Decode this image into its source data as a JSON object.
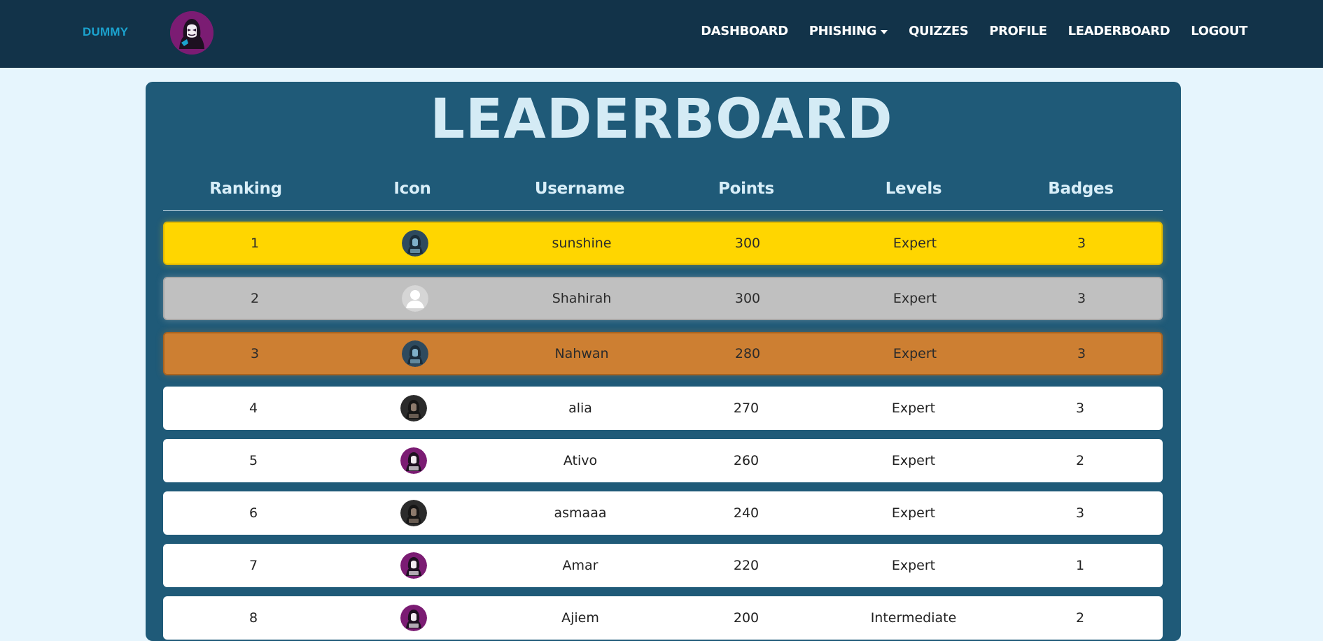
{
  "nav": {
    "brand": "DUMMY",
    "links": [
      {
        "label": "DASHBOARD"
      },
      {
        "label": "PHISHING",
        "dropdown": true
      },
      {
        "label": "QUIZZES"
      },
      {
        "label": "PROFILE"
      },
      {
        "label": "LEADERBOARD"
      },
      {
        "label": "LOGOUT"
      }
    ]
  },
  "page": {
    "title": "LEADERBOARD"
  },
  "table": {
    "headers": [
      "Ranking",
      "Icon",
      "Username",
      "Points",
      "Levels",
      "Badges"
    ],
    "rows": [
      {
        "rank": "1",
        "icon": "hacker-blue-avatar-icon",
        "username": "sunshine",
        "points": "300",
        "level": "Expert",
        "badges": "3"
      },
      {
        "rank": "2",
        "icon": "default-user-avatar-icon",
        "username": "Shahirah",
        "points": "300",
        "level": "Expert",
        "badges": "3"
      },
      {
        "rank": "3",
        "icon": "hacker-blue-avatar-icon",
        "username": "Nahwan",
        "points": "280",
        "level": "Expert",
        "badges": "3"
      },
      {
        "rank": "4",
        "icon": "hacker-dark-avatar-icon",
        "username": "alia",
        "points": "270",
        "level": "Expert",
        "badges": "3"
      },
      {
        "rank": "5",
        "icon": "hacker-purple-avatar-icon",
        "username": "Ativo",
        "points": "260",
        "level": "Expert",
        "badges": "2"
      },
      {
        "rank": "6",
        "icon": "hacker-dark-avatar-icon",
        "username": "asmaaa",
        "points": "240",
        "level": "Expert",
        "badges": "3"
      },
      {
        "rank": "7",
        "icon": "hacker-purple-avatar-icon",
        "username": "Amar",
        "points": "220",
        "level": "Expert",
        "badges": "1"
      },
      {
        "rank": "8",
        "icon": "hacker-purple-avatar-icon",
        "username": "Ajiem",
        "points": "200",
        "level": "Intermediate",
        "badges": "2"
      }
    ]
  },
  "colors": {
    "navbar": "#123349",
    "brand": "#1ba3cf",
    "panel": "#1f5a78",
    "background": "#e6f5fd",
    "gold": "#ffd600",
    "silver": "#c0c0c0",
    "bronze": "#cd7f32",
    "title": "#d4ebf5"
  }
}
